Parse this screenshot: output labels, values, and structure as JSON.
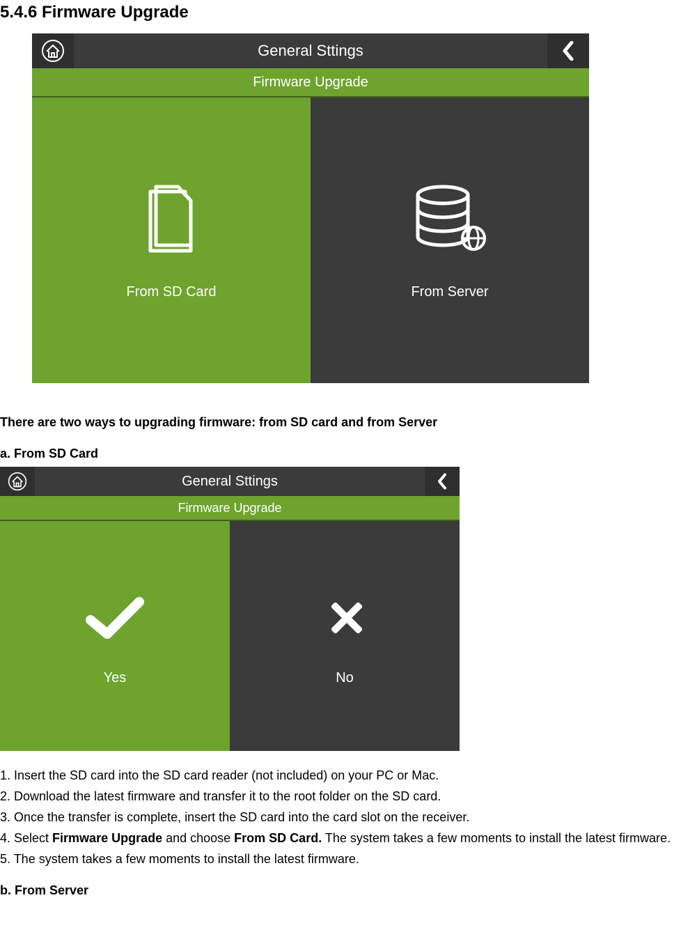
{
  "heading": "5.4.6 Firmware Upgrade",
  "topbar_title": "General Sttings",
  "subbar_title": "Firmware Upgrade",
  "ss1": {
    "tile_left_label": "From SD Card",
    "tile_right_label": "From Server"
  },
  "intro_text": "There are two ways to upgrading firmware: from SD card and from Server",
  "subhead_a": "a. From SD Card",
  "ss2": {
    "tile_left_label": "Yes",
    "tile_right_label": "No"
  },
  "steps": {
    "s1": "1. Insert the SD card into the SD card reader (not included) on your PC or Mac.",
    "s2": "2. Download the latest firmware and transfer it to the root folder on the SD card.",
    "s3": "3. Once the transfer is complete, insert the SD card into the card slot on the receiver.",
    "s4_a": "4. Select ",
    "s4_b": "Firmware Upgrade",
    "s4_c": " and choose ",
    "s4_d": "From SD Card.",
    "s4_e": " The system takes a few moments to install the latest firmware.",
    "s5": "5. The system takes a few moments to install the latest firmware."
  },
  "subhead_b": "b. From Server"
}
